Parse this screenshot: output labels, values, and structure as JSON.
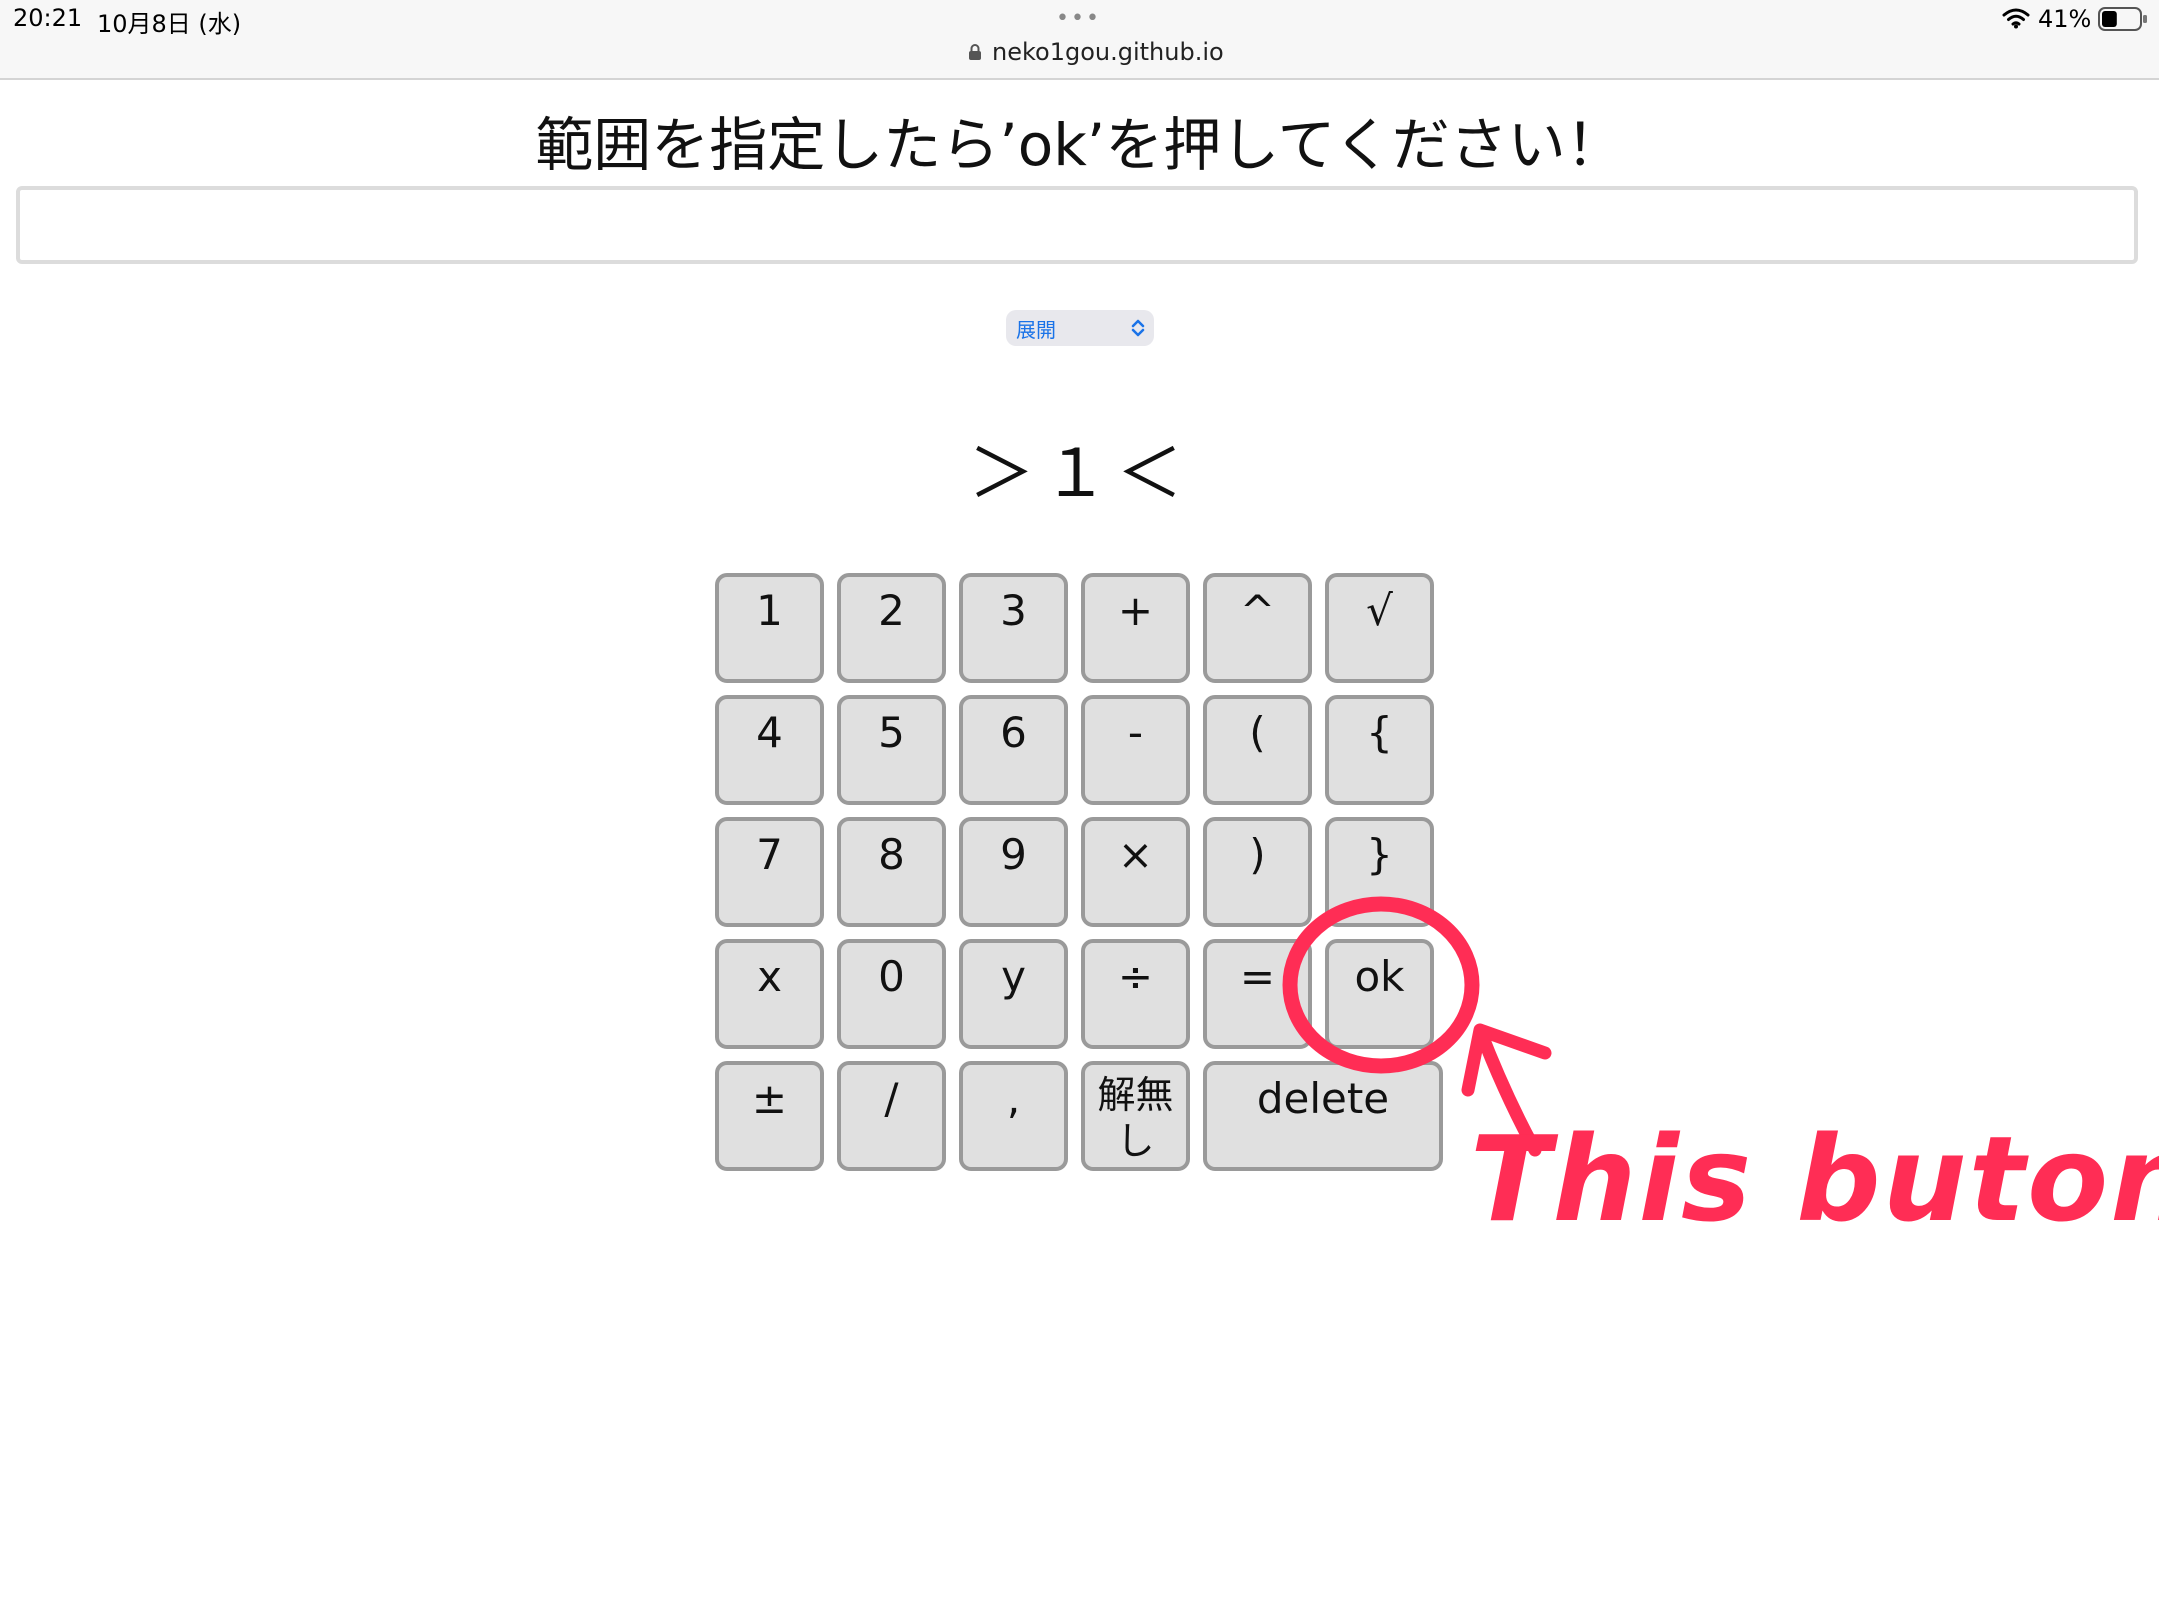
{
  "status_bar": {
    "time": "20:21",
    "date": "10月8日 (水)",
    "battery_percent": "41%",
    "battery_level": 0.41
  },
  "browser": {
    "dots": "•••",
    "url": "neko1gou.github.io"
  },
  "page": {
    "heading": "範囲を指定したら’ok’を押してください！",
    "input": {
      "value": "",
      "placeholder": ""
    },
    "mode_select": {
      "selected": "展開"
    },
    "answer_display": "＞１＜"
  },
  "keypad": {
    "rows": [
      [
        "1",
        "2",
        "3",
        "+",
        "^",
        "√"
      ],
      [
        "4",
        "5",
        "6",
        "-",
        "(",
        "{"
      ],
      [
        "7",
        "8",
        "9",
        "×",
        ")",
        "}"
      ],
      [
        "x",
        "0",
        "y",
        "÷",
        "=",
        "ok"
      ],
      [
        "±",
        "/",
        ",",
        "解無し",
        "delete"
      ]
    ]
  },
  "annotation": {
    "text": "This buton",
    "color": "#ff2d55"
  }
}
